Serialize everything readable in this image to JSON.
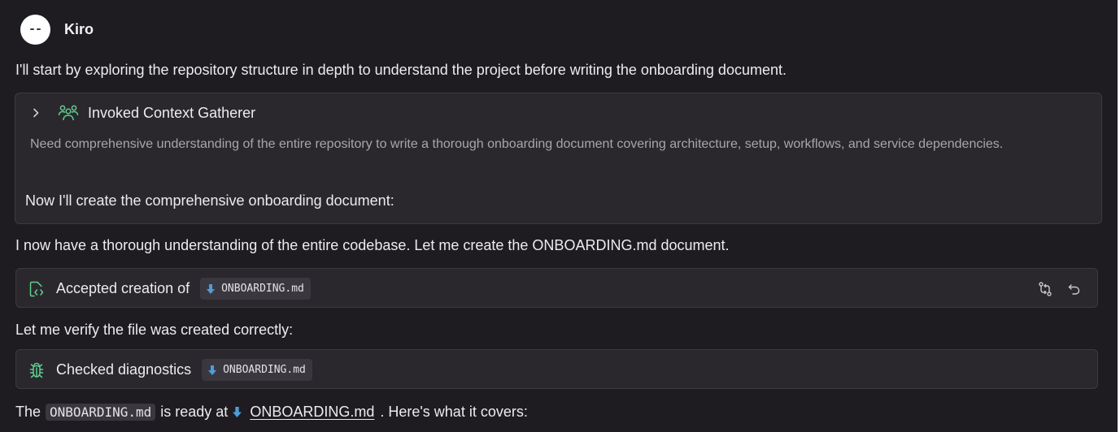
{
  "agent": {
    "name": "Kiro"
  },
  "messages": {
    "intro": "I'll start by exploring the repository structure in depth to understand the project before writing the onboarding document.",
    "context_card": {
      "title": "Invoked Context Gatherer",
      "description": "Need comprehensive understanding of the entire repository to write a thorough onboarding document covering architecture, setup, workflows, and service dependencies.",
      "after": "Now I'll create the comprehensive onboarding document:"
    },
    "understanding": "I now have a thorough understanding of the entire codebase. Let me create the ONBOARDING.md document.",
    "creation_card": {
      "label": "Accepted creation of",
      "file": "ONBOARDING.md"
    },
    "verify": "Let me verify the file was created correctly:",
    "diagnostics_card": {
      "label": "Checked diagnostics",
      "file": "ONBOARDING.md"
    },
    "final": {
      "prefix": "The",
      "code": "ONBOARDING.md",
      "middle": "is ready at",
      "link": "ONBOARDING.md",
      "suffix": ". Here's what it covers:"
    }
  },
  "icons": {
    "avatar": "kiro-ghost-icon",
    "chevron": "chevron-right-icon",
    "context": "people-group-icon",
    "creation": "file-code-icon",
    "diagnostics": "bug-icon",
    "compare": "compare-icon",
    "revert": "undo-icon",
    "file": "markdown-file-icon"
  },
  "colors": {
    "background": "#1e1c21",
    "card": "#2a282d",
    "accent_green": "#5fcf8f",
    "file_blue": "#4d9ddb"
  }
}
